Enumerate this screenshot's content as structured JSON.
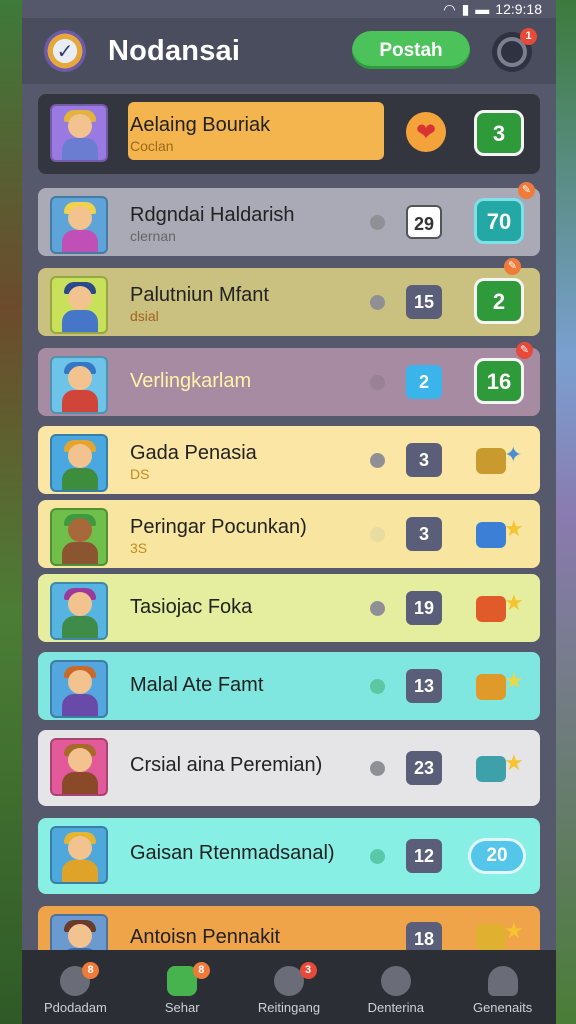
{
  "status": {
    "time": "12:9:18"
  },
  "header": {
    "title": "Nodansai",
    "post_label": "Postah",
    "badge": "1"
  },
  "rows": [
    {
      "title": "Aelaing Bouriak",
      "sub": "Coclan",
      "score": "3"
    },
    {
      "title": "Rdgndai Haldarish",
      "sub": "clernan",
      "count": "29",
      "score": "70"
    },
    {
      "title": "Palutniun Mfant",
      "sub": "dsial",
      "count": "15",
      "score": "2"
    },
    {
      "title": "Verlingkarlam",
      "count": "2",
      "score": "16"
    },
    {
      "title": "Gada Penasia",
      "sub": "DS",
      "count": "3"
    },
    {
      "title": "Peringar Pocunkan)",
      "sub": "3S",
      "count": "3"
    },
    {
      "title": "Tasiojac Foka",
      "count": "19"
    },
    {
      "title": "Malal Ate Famt",
      "count": "13"
    },
    {
      "title": "Crsial aina Peremian)",
      "count": "23"
    },
    {
      "title": "Gaisan Rtenmadsanal)",
      "count": "12",
      "score": "20"
    },
    {
      "title": "Antoisn Pennakit",
      "count": "18"
    }
  ],
  "colors": {
    "row_backgrounds": [
      "#f4b44e",
      "#a9aab6",
      "#cac07f",
      "#a78ba3",
      "#fbe6a6",
      "#f8e6a0",
      "#e5ee9e",
      "#7fe6e0",
      "#e5e5e8",
      "#88efe4",
      "#f0a44a"
    ]
  },
  "tabs": [
    {
      "label": "Pdodadam",
      "badge": "8"
    },
    {
      "label": "Sehar",
      "badge": "8"
    },
    {
      "label": "Reitingang",
      "badge": "3"
    },
    {
      "label": "Denterina"
    },
    {
      "label": "Genenaits"
    }
  ]
}
